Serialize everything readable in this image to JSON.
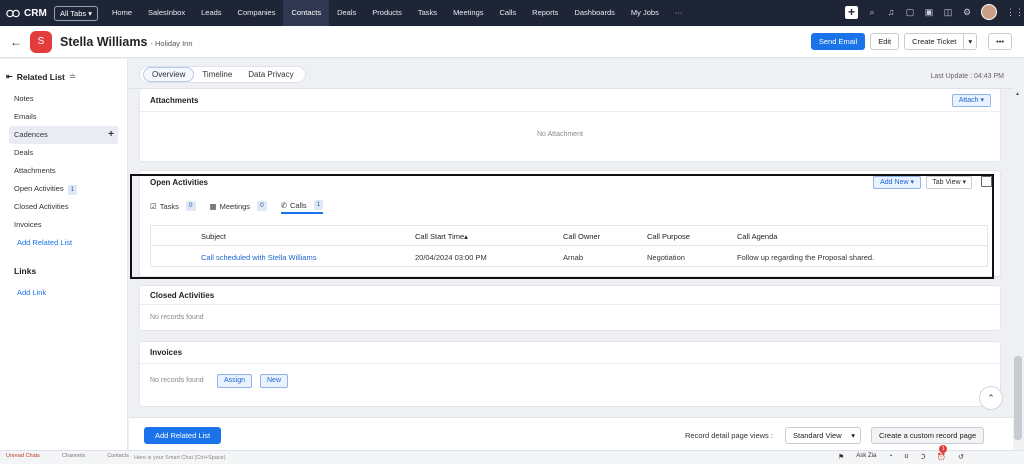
{
  "nav": {
    "crm_label": "CRM",
    "all_tabs": "All Tabs ▾",
    "items": [
      "Home",
      "SalesInbox",
      "Leads",
      "Companies",
      "Contacts",
      "Deals",
      "Products",
      "Tasks",
      "Meetings",
      "Calls",
      "Reports",
      "Dashboards",
      "My Jobs",
      "···"
    ],
    "active_item": "Contacts"
  },
  "record": {
    "avatar_letter": "S",
    "name": "Stella Williams",
    "account": "- Holiday Inn",
    "buttons": {
      "send_email": "Send Email",
      "edit": "Edit",
      "create_ticket": "Create Ticket",
      "split": "▾",
      "more": "•••"
    }
  },
  "sidebar": {
    "title": "Related List",
    "items": [
      {
        "label": "Notes"
      },
      {
        "label": "Emails"
      },
      {
        "label": "Cadences"
      },
      {
        "label": "Deals"
      },
      {
        "label": "Attachments"
      },
      {
        "label": "Open Activities",
        "count": "1"
      },
      {
        "label": "Closed Activities"
      },
      {
        "label": "Invoices"
      }
    ],
    "add_related": "Add Related List",
    "links_title": "Links",
    "add_link": "Add Link"
  },
  "tabs": [
    "Overview",
    "Timeline",
    "Data Privacy"
  ],
  "last_update": "Last Update : 04:43 PM",
  "attachments": {
    "title": "Attachments",
    "attach_btn": "Attach ▾",
    "empty": "No Attachment"
  },
  "open_activities": {
    "title": "Open Activities",
    "add_new": "Add New ▾",
    "view": "Tab View ▾",
    "tabs": [
      {
        "label": "Tasks",
        "count": "0"
      },
      {
        "label": "Meetings",
        "count": "0"
      },
      {
        "label": "Calls",
        "count": "1"
      }
    ],
    "columns": [
      "Subject",
      "Call Start Time▴",
      "Call Owner",
      "Call Purpose",
      "Call Agenda"
    ],
    "rows": [
      {
        "subject": "Call scheduled with Stella Williams",
        "start": "20/04/2024 03:00 PM",
        "owner": "Arnab",
        "purpose": "Negotiation",
        "agenda": "Follow up regarding the Proposal shared."
      }
    ]
  },
  "closed_activities": {
    "title": "Closed Activities",
    "empty": "No records found"
  },
  "invoices": {
    "title": "Invoices",
    "empty": "No records found",
    "assign": "Assign",
    "new": "New"
  },
  "footer": {
    "add_related": "Add Related List",
    "view_label": "Record detail page views :",
    "view_value": "Standard View",
    "custom_btn": "Create a custom record page"
  },
  "bottom": {
    "chat_hint": "Here is your Smart Chat (Ctrl+Space)",
    "ask_zia": "Ask Zia",
    "left_items": [
      "Unread Chats",
      "Channels",
      "Contacts"
    ],
    "badge": "1"
  }
}
